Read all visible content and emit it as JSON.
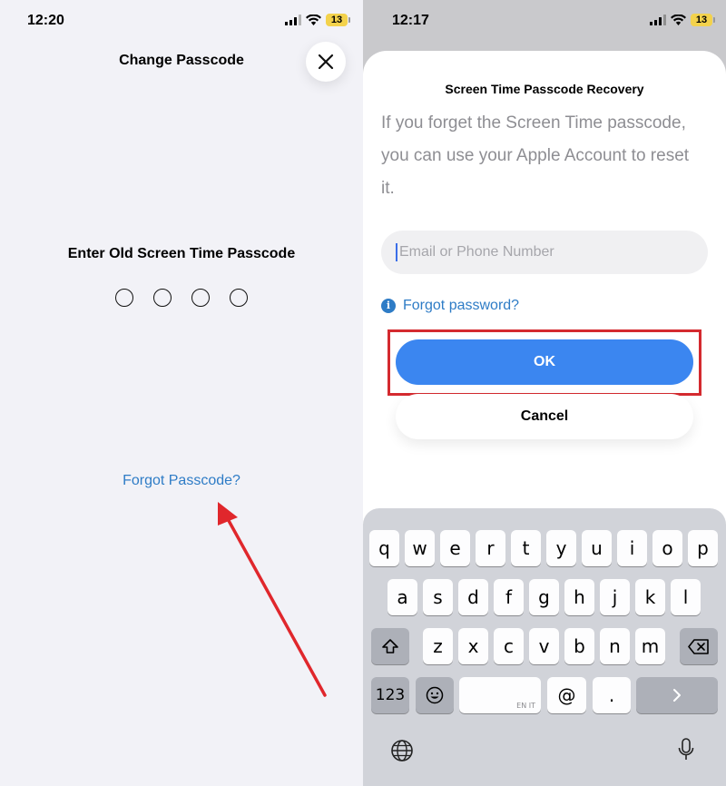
{
  "left": {
    "status_time": "12:20",
    "battery": "13",
    "title": "Change Passcode",
    "prompt": "Enter Old Screen Time Passcode",
    "forgot_link": "Forgot Passcode?"
  },
  "right": {
    "status_time": "12:17",
    "battery": "13",
    "sheet_title": "Screen Time Passcode Recovery",
    "description": "If you forget the Screen Time passcode, you can use your Apple Account to reset it.",
    "email_placeholder": "Email or Phone Number",
    "forgot_password": "Forgot password?",
    "ok_label": "OK",
    "cancel_label": "Cancel",
    "keyboard": {
      "row1": [
        "q",
        "w",
        "e",
        "r",
        "t",
        "y",
        "u",
        "i",
        "o",
        "p"
      ],
      "row2": [
        "a",
        "s",
        "d",
        "f",
        "g",
        "h",
        "j",
        "k",
        "l"
      ],
      "row3": [
        "z",
        "x",
        "c",
        "v",
        "b",
        "n",
        "m"
      ],
      "numbers_key": "123",
      "period_key": ".",
      "at_key": "@",
      "space_lang": "EN IT"
    }
  },
  "colors": {
    "link_blue": "#2e7cc6",
    "ok_blue": "#3b86f0",
    "highlight_red": "#d42a2f",
    "arrow_red": "#e0272c"
  },
  "icons": [
    "close-icon",
    "signal-icon",
    "wifi-icon",
    "info-icon",
    "shift-icon",
    "backspace-icon",
    "emoji-icon",
    "return-arrow-icon",
    "globe-icon",
    "microphone-icon"
  ]
}
